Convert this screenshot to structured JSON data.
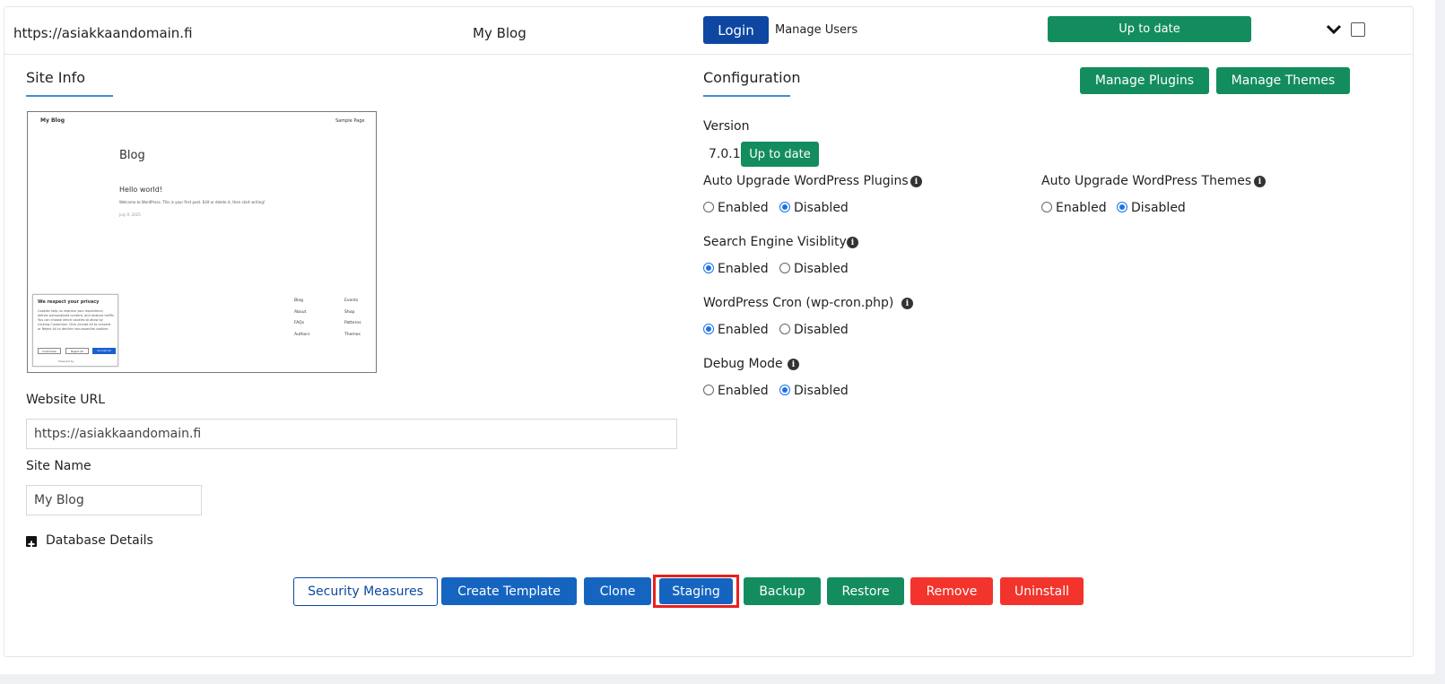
{
  "header": {
    "url": "https://asiakkaandomain.fi",
    "site_name": "My Blog",
    "login_label": "Login",
    "manage_users_label": "Manage Users",
    "status_label": "Up to date"
  },
  "site_info": {
    "title": "Site Info",
    "thumbnail": {
      "site_title": "My Blog",
      "nav_link": "Sample Page",
      "heading": "Blog",
      "post_title": "Hello world!",
      "post_excerpt": "Welcome to WordPress. This is your first post. Edit or delete it, then start writing!",
      "post_date": "July 9, 2025",
      "cookie_title": "We respect your privacy",
      "cookie_text": "Cookies help us improve your experience, deliver personalized content, and analyze traffic. You can choose which cookies to allow by clicking Customize. Click Accept All to consent or Reject All to decline non-essential cookies.",
      "cookie_customize": "Customize",
      "cookie_reject": "Reject All",
      "cookie_accept": "Accept All",
      "cookie_powered": "Powered by",
      "footer_col1": [
        "Blog",
        "About",
        "FAQs",
        "Authors"
      ],
      "footer_col2": [
        "Events",
        "Shop",
        "Patterns",
        "Themes"
      ]
    },
    "website_url_label": "Website URL",
    "website_url_value": "https://asiakkaandomain.fi",
    "site_name_label": "Site Name",
    "site_name_value": "My Blog",
    "database_details_label": "Database Details"
  },
  "configuration": {
    "title": "Configuration",
    "manage_plugins_label": "Manage Plugins",
    "manage_themes_label": "Manage Themes",
    "version_label": "Version",
    "version_value": "7.0.1",
    "version_status": "Up to date",
    "options": {
      "enabled": "Enabled",
      "disabled": "Disabled"
    },
    "auto_upgrade_plugins": {
      "label": "Auto Upgrade WordPress Plugins",
      "value": "Disabled"
    },
    "auto_upgrade_themes": {
      "label": "Auto Upgrade WordPress Themes",
      "value": "Disabled"
    },
    "search_engine_visibility": {
      "label": "Search Engine Visiblity",
      "value": "Enabled"
    },
    "wp_cron": {
      "label": "WordPress Cron (wp-cron.php)",
      "value": "Enabled"
    },
    "debug_mode": {
      "label": "Debug Mode",
      "value": "Disabled"
    }
  },
  "actions": {
    "security_measures": "Security Measures",
    "create_template": "Create Template",
    "clone": "Clone",
    "staging": "Staging",
    "backup": "Backup",
    "restore": "Restore",
    "remove": "Remove",
    "uninstall": "Uninstall"
  },
  "colors": {
    "primary_blue": "#1565c0",
    "navy": "#0d47a1",
    "green": "#138d5e",
    "red": "#f2342c",
    "highlight": "#e8201c"
  }
}
